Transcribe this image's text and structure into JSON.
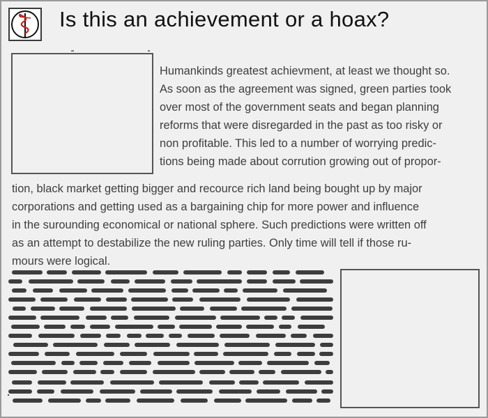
{
  "page": {
    "title": "Is this an achievement or a hoax?",
    "article_lines": [
      "Humankinds greatest achievment, at least we thought so.",
      "As soon as the agreement was signed, green parties took",
      "over most of the government seats and began planning",
      "reforms that were disregarded in the past as too risky or",
      "non profitable. This led to a number of worrying predic-",
      "tions being made about corrution growing out of propor-",
      "tion, black market getting bigger and recource rich land being bought up by major",
      "corporations and getting used as a bargaining chip for more power and influence",
      "in the surounding economical or national sphere. Such predictions were written off",
      "as an attempt to destabilize the new ruling parties. Only time will tell if  those ru-",
      "mours were logical."
    ],
    "colors": {
      "background": "#f0f0f0",
      "text": "#3e3e3e",
      "title": "#111111",
      "placeholder_bars": "#3d3d3d",
      "logo_accent": "#c8201e"
    },
    "icons": {
      "logo": "caduceus-emblem-icon"
    }
  }
}
